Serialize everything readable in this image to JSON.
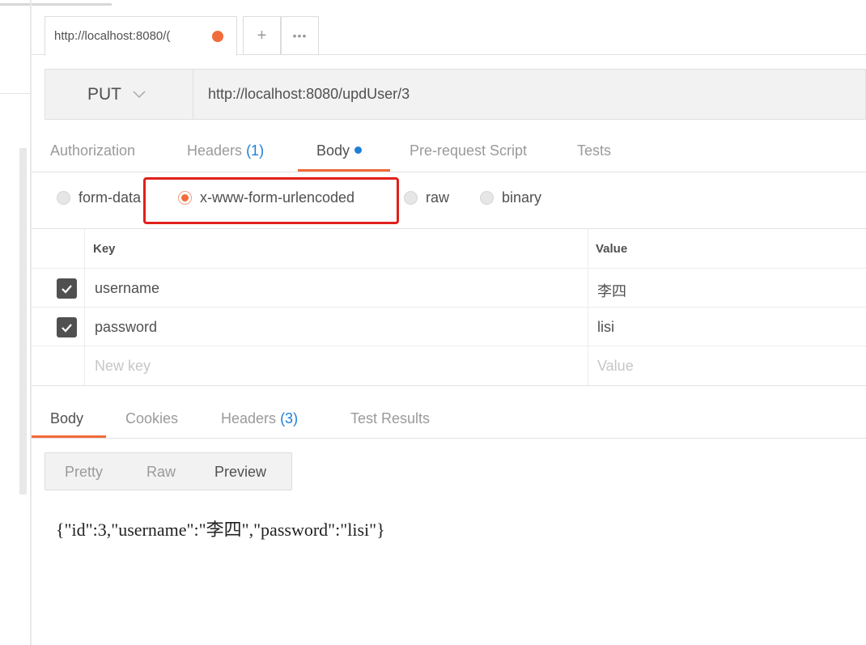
{
  "tab": {
    "title": "http://localhost:8080/(",
    "more": "•••",
    "plus": "+"
  },
  "request": {
    "method": "PUT",
    "url": "http://localhost:8080/updUser/3"
  },
  "subtabs": {
    "authorization": "Authorization",
    "headers": "Headers",
    "headers_count": "(1)",
    "body": "Body",
    "prerequest": "Pre-request Script",
    "tests": "Tests"
  },
  "body_modes": {
    "form_data": "form-data",
    "urlencoded": "x-www-form-urlencoded",
    "raw": "raw",
    "binary": "binary",
    "selected": "x-www-form-urlencoded"
  },
  "params": {
    "headers": {
      "key": "Key",
      "value": "Value"
    },
    "rows": [
      {
        "key": "username",
        "value": "李四",
        "checked": true
      },
      {
        "key": "password",
        "value": "lisi",
        "checked": true
      }
    ],
    "new_key_placeholder": "New key",
    "new_value_placeholder": "Value"
  },
  "response": {
    "tabs": {
      "body": "Body",
      "cookies": "Cookies",
      "headers": "Headers",
      "headers_count": "(3)",
      "test_results": "Test Results"
    },
    "views": {
      "pretty": "Pretty",
      "raw": "Raw",
      "preview": "Preview"
    },
    "content": "{\"id\":3,\"username\":\"李四\",\"password\":\"lisi\"}"
  },
  "colors": {
    "accent": "#f26b3a",
    "link_blue": "#1f7fd6",
    "highlight": "#e0201b"
  },
  "icons": {
    "checkbox": "check-icon",
    "method_dropdown": "chevron-down-icon"
  }
}
